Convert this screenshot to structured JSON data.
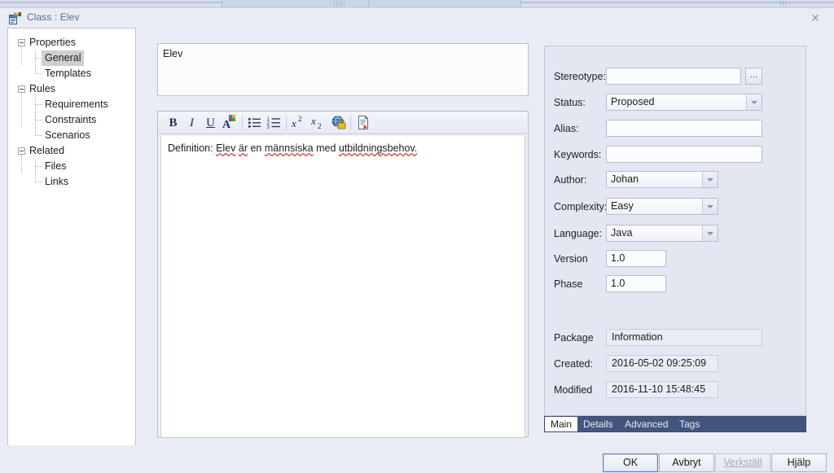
{
  "window": {
    "title": "Class : Elev",
    "icon": "class-diagram-icon",
    "close_label": "✕"
  },
  "tree": {
    "nodes": [
      {
        "label": "Properties",
        "level": 0,
        "expanded": true,
        "selected": false
      },
      {
        "label": "General",
        "level": 1,
        "expanded": false,
        "selected": true
      },
      {
        "label": "Templates",
        "level": 1,
        "expanded": false,
        "selected": false
      },
      {
        "label": "Rules",
        "level": 0,
        "expanded": true,
        "selected": false
      },
      {
        "label": "Requirements",
        "level": 1,
        "expanded": false,
        "selected": false
      },
      {
        "label": "Constraints",
        "level": 1,
        "expanded": false,
        "selected": false
      },
      {
        "label": "Scenarios",
        "level": 1,
        "expanded": false,
        "selected": false
      },
      {
        "label": "Related",
        "level": 0,
        "expanded": true,
        "selected": false
      },
      {
        "label": "Files",
        "level": 1,
        "expanded": false,
        "selected": false
      },
      {
        "label": "Links",
        "level": 1,
        "expanded": false,
        "selected": false
      }
    ]
  },
  "name_field": {
    "value": "Elev",
    "placeholder": ""
  },
  "editor": {
    "toolbar": [
      {
        "name": "bold-icon",
        "glyph": "B"
      },
      {
        "name": "italic-icon",
        "glyph": "I"
      },
      {
        "name": "underline-icon",
        "glyph": "U"
      },
      {
        "name": "font-color-icon",
        "glyph": "A"
      },
      {
        "name": "bullet-list-icon",
        "glyph": ""
      },
      {
        "name": "numbered-list-icon",
        "glyph": ""
      },
      {
        "name": "superscript-icon",
        "glyph": "x"
      },
      {
        "name": "subscript-icon",
        "glyph": "x"
      },
      {
        "name": "hyperlink-icon",
        "glyph": ""
      },
      {
        "name": "insert-document-icon",
        "glyph": ""
      }
    ],
    "text_prefix": "Definition: ",
    "word1": "Elev",
    "word2": "är",
    "mid1": " en ",
    "word3": "männsiska",
    "mid2": " med ",
    "word4": "utbildningsbehov.",
    "full_text": "Definition: Elev är en männsiska med utbildningsbehov."
  },
  "properties": {
    "fields": [
      {
        "label": "Stereotype:",
        "value": "",
        "type": "text-with-browse",
        "browse_label": "..."
      },
      {
        "label": "Status:",
        "value": "Proposed",
        "type": "combo"
      },
      {
        "label": "Alias:",
        "value": "",
        "type": "text"
      },
      {
        "label": "Keywords:",
        "value": "",
        "type": "text"
      },
      {
        "label": "Author:",
        "value": "Johan",
        "type": "combo"
      },
      {
        "label": "Complexity:",
        "value": "Easy",
        "type": "combo"
      },
      {
        "label": "Language:",
        "value": "Java",
        "type": "combo"
      },
      {
        "label": "Version",
        "value": "1.0",
        "type": "text-small"
      },
      {
        "label": "Phase",
        "value": "1.0",
        "type": "text-small"
      },
      {
        "label": "Package",
        "value": "Information",
        "type": "readonly"
      },
      {
        "label": "Created:",
        "value": "2016-05-02 09:25:09",
        "type": "readonly-date"
      },
      {
        "label": "Modified",
        "value": "2016-11-10 15:48:45",
        "type": "readonly-date"
      }
    ]
  },
  "tabs": [
    {
      "label": "Main",
      "active": true
    },
    {
      "label": "Details",
      "active": false
    },
    {
      "label": "Advanced",
      "active": false
    },
    {
      "label": "Tags",
      "active": false
    }
  ],
  "footer": {
    "buttons": [
      {
        "label": "OK",
        "state": "default"
      },
      {
        "label": "Avbryt",
        "state": "normal"
      },
      {
        "label": "Verkställ",
        "state": "disabled"
      },
      {
        "label": "Hjälp",
        "state": "normal"
      }
    ]
  },
  "colors": {
    "dialog_bg": "#e9ecf4",
    "panel_bg": "#e3e7f1",
    "tabstrip_bg": "#44557d",
    "accent_border": "#5b7fb9",
    "spellcheck_underline": "#d33a2c",
    "selection_bg": "#cfcfcf"
  }
}
